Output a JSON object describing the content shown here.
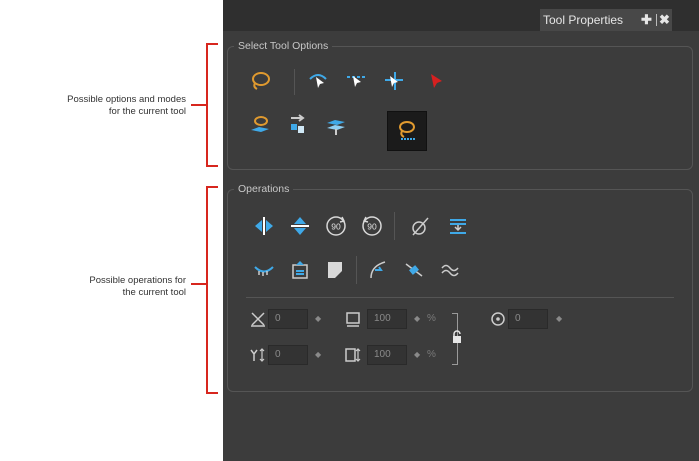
{
  "annotations": {
    "select_options": [
      "Possible options and modes",
      "for the current tool"
    ],
    "operations": [
      "Possible operations for",
      "the current tool"
    ]
  },
  "panel": {
    "tab_title": "Tool Properties",
    "tab_icons": [
      "plus-icon",
      "close-icon"
    ]
  },
  "select_tool_options": {
    "title": "Select Tool Options",
    "row1": [
      "lasso-icon",
      "snap-to-contour-icon",
      "snap-and-align-icon",
      "snap-to-thickness-icon",
      "works-on-single-drawing-icon"
    ],
    "row2": [
      "select-by-color-icon",
      "apply-to-all-frames-icon",
      "flatten-icon",
      "lasso-mode-selected-icon"
    ],
    "selected_index": 3
  },
  "operations": {
    "title": "Operations",
    "row1": [
      "flip-horizontal-icon",
      "flip-vertical-icon",
      "rotate-90-cw-icon",
      "rotate-90-ccw-icon",
      "pencil-to-brush-icon",
      "distribute-icon"
    ],
    "row2": [
      "smooth-icon",
      "create-empty-drawing-icon",
      "fill-icon",
      "adjust-curve-icon",
      "cut-icon",
      "wave-icon"
    ],
    "labels": {
      "rotate_cw": "90",
      "rotate_ccw": "90"
    },
    "fields": {
      "x": {
        "value": "0"
      },
      "y": {
        "value": "0"
      },
      "width": {
        "value": "100",
        "unit": "%"
      },
      "height": {
        "value": "100",
        "unit": "%"
      },
      "angle": {
        "value": "0"
      }
    }
  },
  "colors": {
    "annotation_red": "#d7261e",
    "panel_bg": "#3c3c3c",
    "icon_blue": "#3fa9e8",
    "icon_orange": "#e09a2f",
    "arrow_red": "#d62020"
  }
}
